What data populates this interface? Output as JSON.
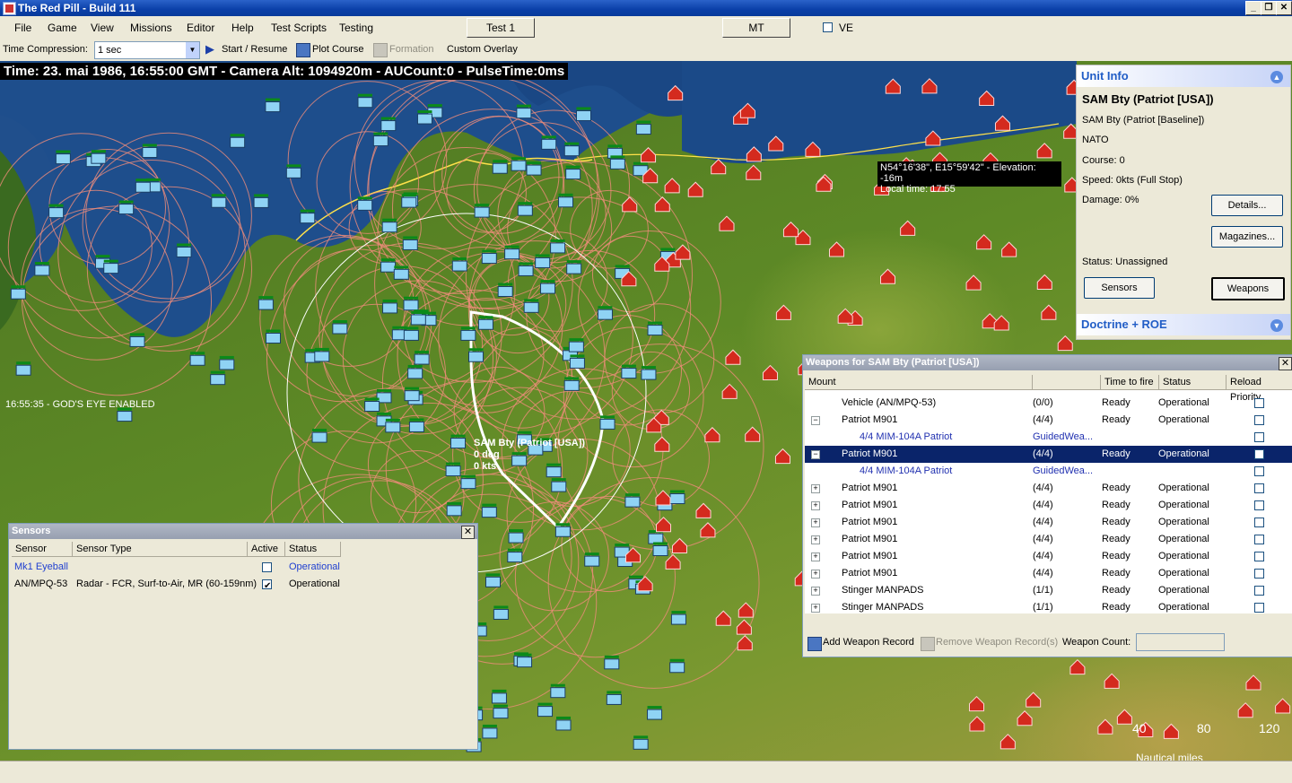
{
  "window": {
    "title": "The Red Pill - Build 111",
    "min": "_",
    "restore": "❐",
    "close": "✕"
  },
  "menu": {
    "items": [
      "File",
      "Game",
      "View",
      "Missions",
      "Editor",
      "Help",
      "Test Scripts",
      "Testing"
    ]
  },
  "top_buttons": {
    "test1": "Test 1",
    "mt": "MT",
    "ve_label": "VE"
  },
  "toolbar": {
    "time_compression_label": "Time Compression:",
    "time_compression_value": "1 sec",
    "start_resume": "Start / Resume",
    "plot_course": "Plot Course",
    "formation": "Formation",
    "custom_overlay": "Custom Overlay"
  },
  "map": {
    "time_banner": "Time: 23. mai 1986, 16:55:00 GMT - Camera Alt: 1094920m - AUCount:0 - PulseTime:0ms",
    "gods_eye": "16:55:35 - GOD'S EYE ENABLED",
    "coord_line1": "N54°16'38\", E15°59'42\" - Elevation: -16m",
    "coord_line2": "Local time: 17:55",
    "selected_unit_label_1": "SAM Bty (Patriot [USA])",
    "selected_unit_label_2": "0 deg",
    "selected_unit_label_3": "0 kts",
    "scale": {
      "t1": "40",
      "t2": "80",
      "t3": "120",
      "unit": "Nautical miles"
    },
    "colors": {
      "friendly": "#8fd3f4",
      "hostile": "#d42a1e",
      "range_ring": "#ef8c7a",
      "land": "#5e8a26",
      "water": "#1c4a86"
    }
  },
  "unit_info": {
    "header": "Unit Info",
    "name": "SAM Bty (Patriot [USA])",
    "class": "SAM Bty (Patriot [Baseline])",
    "side": "NATO",
    "course": "Course: 0",
    "speed": "Speed: 0kts (Full Stop)",
    "damage": "Damage: 0%",
    "status": "Status: Unassigned",
    "details_btn": "Details...",
    "magazines_btn": "Magazines...",
    "sensors_btn": "Sensors",
    "weapons_btn": "Weapons",
    "doctrine": "Doctrine + ROE"
  },
  "weapons_panel": {
    "title": "Weapons for SAM Bty (Patriot [USA])",
    "columns": [
      "Mount",
      "",
      "Time to fire",
      "Status",
      "Reload Priority"
    ],
    "rows": [
      {
        "expander": "",
        "mount": "Vehicle (AN/MPQ-53)",
        "qty": "(0/0)",
        "ttf": "Ready",
        "status": "Operational",
        "sub": false,
        "selected": false
      },
      {
        "expander": "−",
        "mount": "Patriot M901",
        "qty": "(4/4)",
        "ttf": "Ready",
        "status": "Operational",
        "sub": false,
        "selected": false
      },
      {
        "expander": "",
        "mount": "4/4  MIM-104A Patriot",
        "qty": "GuidedWea...",
        "ttf": "",
        "status": "",
        "sub": true,
        "selected": false
      },
      {
        "expander": "−",
        "mount": "Patriot M901",
        "qty": "(4/4)",
        "ttf": "Ready",
        "status": "Operational",
        "sub": false,
        "selected": true
      },
      {
        "expander": "",
        "mount": "4/4  MIM-104A Patriot",
        "qty": "GuidedWea...",
        "ttf": "",
        "status": "",
        "sub": true,
        "selected": false
      },
      {
        "expander": "+",
        "mount": "Patriot M901",
        "qty": "(4/4)",
        "ttf": "Ready",
        "status": "Operational",
        "sub": false,
        "selected": false
      },
      {
        "expander": "+",
        "mount": "Patriot M901",
        "qty": "(4/4)",
        "ttf": "Ready",
        "status": "Operational",
        "sub": false,
        "selected": false
      },
      {
        "expander": "+",
        "mount": "Patriot M901",
        "qty": "(4/4)",
        "ttf": "Ready",
        "status": "Operational",
        "sub": false,
        "selected": false
      },
      {
        "expander": "+",
        "mount": "Patriot M901",
        "qty": "(4/4)",
        "ttf": "Ready",
        "status": "Operational",
        "sub": false,
        "selected": false
      },
      {
        "expander": "+",
        "mount": "Patriot M901",
        "qty": "(4/4)",
        "ttf": "Ready",
        "status": "Operational",
        "sub": false,
        "selected": false
      },
      {
        "expander": "+",
        "mount": "Patriot M901",
        "qty": "(4/4)",
        "ttf": "Ready",
        "status": "Operational",
        "sub": false,
        "selected": false
      },
      {
        "expander": "+",
        "mount": "Stinger MANPADS",
        "qty": "(1/1)",
        "ttf": "Ready",
        "status": "Operational",
        "sub": false,
        "selected": false
      },
      {
        "expander": "+",
        "mount": "Stinger MANPADS",
        "qty": "(1/1)",
        "ttf": "Ready",
        "status": "Operational",
        "sub": false,
        "selected": false
      }
    ],
    "add_record": "Add Weapon Record",
    "remove_record": "Remove Weapon Record(s)",
    "weapon_count_label": "Weapon Count:",
    "weapon_count_value": ""
  },
  "sensors_panel": {
    "title": "Sensors",
    "columns": [
      "Sensor",
      "Sensor Type",
      "Active",
      "Status"
    ],
    "rows": [
      {
        "sensor": "Mk1 Eyeball",
        "type": "",
        "active": false,
        "status": "Operational",
        "link": true
      },
      {
        "sensor": "AN/MPQ-53",
        "type": "Radar - FCR, Surf-to-Air, MR (60-159nm)",
        "active": true,
        "status": "Operational",
        "link": false
      }
    ]
  }
}
